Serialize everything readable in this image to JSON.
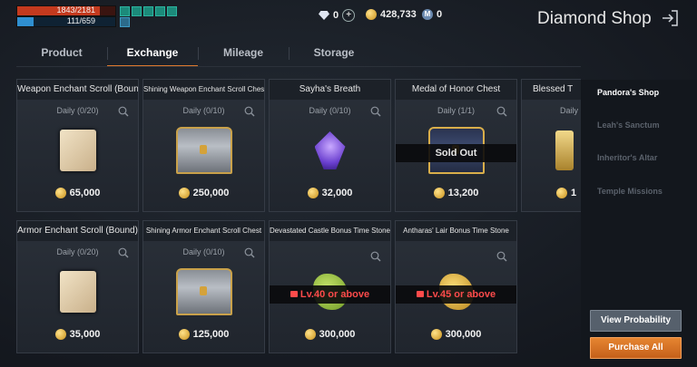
{
  "status": {
    "hp_text": "1843/2181",
    "hp_fraction": 0.845,
    "mp_text": "111/659",
    "mp_fraction": 0.168
  },
  "currency": {
    "diamonds": "0",
    "adena": "428,733",
    "mileage": "0"
  },
  "header": {
    "title": "Diamond Shop"
  },
  "tabs": [
    {
      "label": "Product",
      "active": false
    },
    {
      "label": "Exchange",
      "active": true
    },
    {
      "label": "Mileage",
      "active": false
    },
    {
      "label": "Storage",
      "active": false
    }
  ],
  "items": [
    {
      "name": "Weapon Enchant Scroll (Bound)",
      "limit": "Daily (0/20)",
      "price": "65,000",
      "icon": "weapon-scroll-icon"
    },
    {
      "name": "Shining Weapon Enchant Scroll Chest",
      "limit": "Daily (0/10)",
      "price": "250,000",
      "icon": "silver-chest-icon"
    },
    {
      "name": "Sayha's Breath",
      "limit": "Daily (0/10)",
      "price": "32,000",
      "icon": "purple-crystal-icon"
    },
    {
      "name": "Medal of Honor Chest",
      "limit": "Daily (1/1)",
      "price": "13,200",
      "status": "Sold Out",
      "icon": "gold-chest-icon"
    },
    {
      "name": "Blessed T",
      "limit": "Daily",
      "price": "1",
      "icon": "blessed-item-icon"
    },
    {
      "name": "Armor Enchant Scroll (Bound)",
      "limit": "Daily (0/20)",
      "price": "35,000",
      "icon": "armor-scroll-icon"
    },
    {
      "name": "Shining Armor Enchant Scroll Chest",
      "limit": "Daily (0/10)",
      "price": "125,000",
      "icon": "silver-chest-icon"
    },
    {
      "name": "Devastated Castle Bonus Time Stone",
      "limit": "",
      "price": "300,000",
      "status": "Lv.40 or above",
      "icon": "green-stone-icon"
    },
    {
      "name": "Antharas' Lair Bonus Time Stone",
      "limit": "",
      "price": "300,000",
      "status": "Lv.45 or above",
      "icon": "gold-stone-icon"
    }
  ],
  "side_menu": [
    {
      "label": "Pandora's Shop",
      "active": true
    },
    {
      "label": "Leah's Sanctum",
      "active": false
    },
    {
      "label": "Inheritor's Altar",
      "active": false
    },
    {
      "label": "Temple Missions",
      "active": false
    }
  ],
  "buttons": {
    "view_probability": "View Probability",
    "purchase_all": "Purchase All"
  },
  "colors": {
    "accent": "#e07a2e",
    "hp": "#c43a1e",
    "mp": "#2f8fd0",
    "locked_text": "#ff4b4b"
  }
}
